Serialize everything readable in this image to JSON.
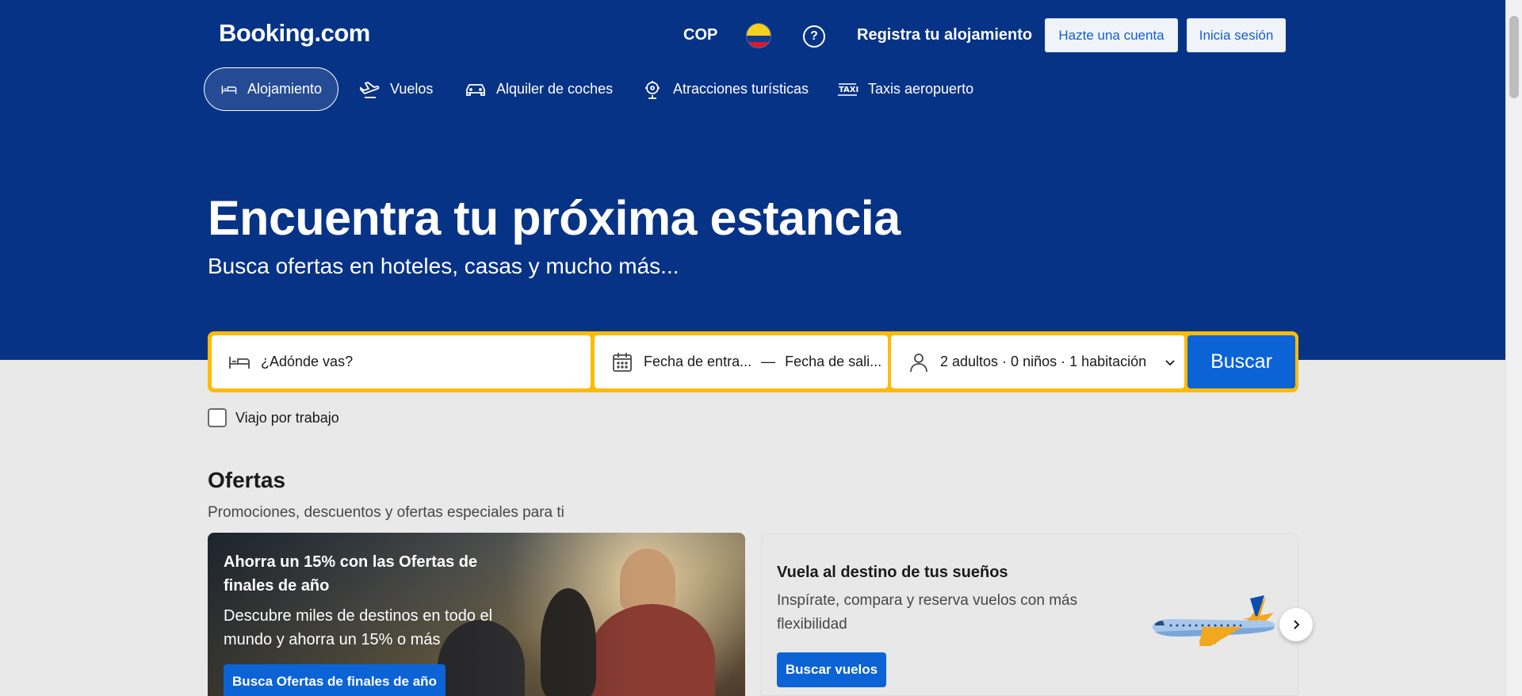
{
  "header": {
    "logo": "Booking.com",
    "currency": "COP",
    "register_property": "Registra tu alojamiento",
    "create_account": "Hazte una cuenta",
    "sign_in": "Inicia sesión"
  },
  "nav": {
    "items": [
      {
        "label": "Alojamiento",
        "icon": "bed-icon",
        "active": true
      },
      {
        "label": "Vuelos",
        "icon": "plane-icon"
      },
      {
        "label": "Alquiler de coches",
        "icon": "car-icon"
      },
      {
        "label": "Atracciones turísticas",
        "icon": "attractions-icon"
      },
      {
        "label": "Taxis aeropuerto",
        "icon": "taxi-icon"
      }
    ]
  },
  "hero": {
    "title": "Encuentra tu próxima estancia",
    "subtitle": "Busca ofertas en hoteles, casas y mucho más..."
  },
  "search": {
    "destination_placeholder": "¿Adónde vas?",
    "checkin": "Fecha de entra...",
    "separator": "—",
    "checkout": "Fecha de sali...",
    "occupancy": "2 adultos · 0 niños · 1 habitación",
    "button": "Buscar",
    "work_trip": "Viajo por trabajo"
  },
  "offers": {
    "title": "Ofertas",
    "subtitle": "Promociones, descuentos y ofertas especiales para ti",
    "card1": {
      "title": "Ahorra un 15% con las Ofertas de finales de año",
      "description": "Descubre miles de destinos en todo el mundo y ahorra un 15% o más",
      "button": "Busca Ofertas de finales de año"
    },
    "card2": {
      "title": "Vuela al destino de tus sueños",
      "description": "Inspírate, compara y reserva vuelos con más flexibilidad",
      "button": "Buscar vuelos"
    }
  },
  "colors": {
    "brand_blue": "#063386",
    "accent_blue": "#0c63d6",
    "search_border": "#febb02"
  }
}
